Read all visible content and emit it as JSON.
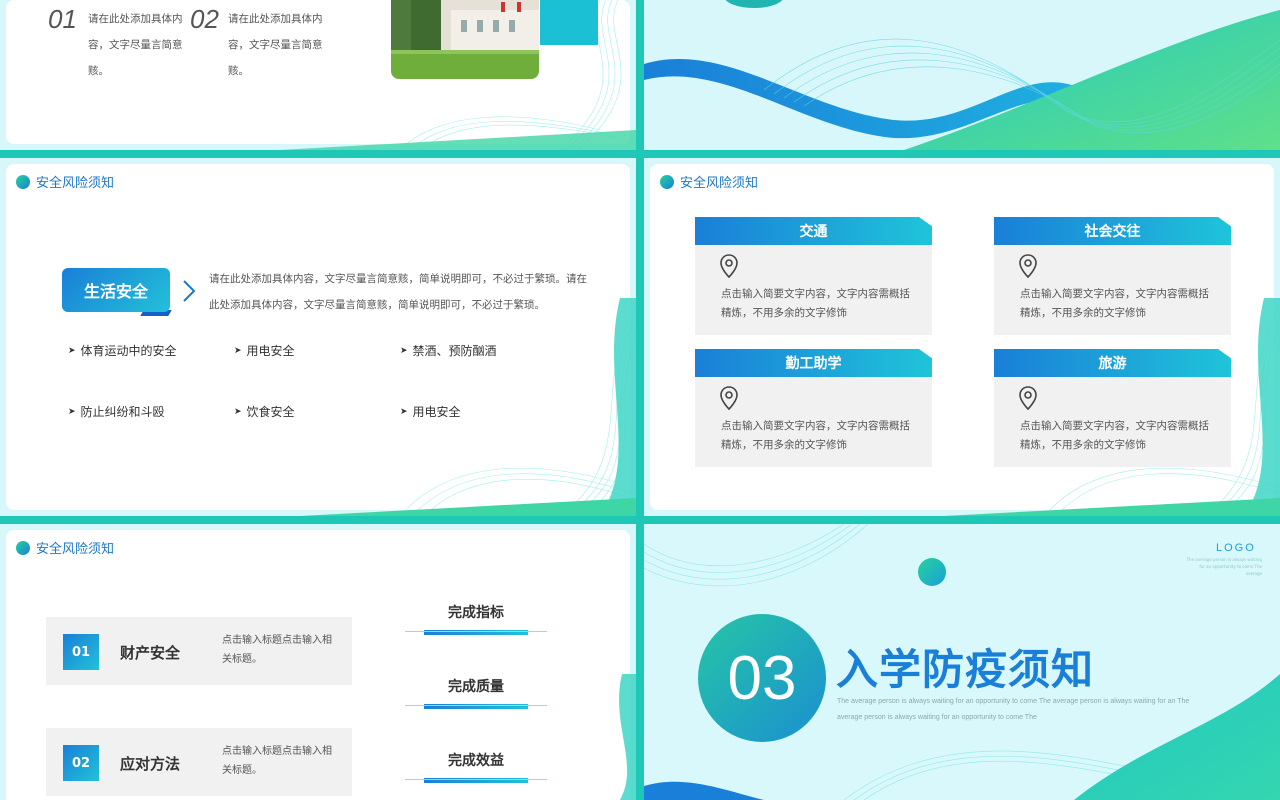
{
  "slide1": {
    "items": [
      {
        "num": "01",
        "text": "请在此处添加具体内容，文字尽量言简意赅。"
      },
      {
        "num": "02",
        "text": "请在此处添加具体内容，文字尽量言简意赅。"
      }
    ]
  },
  "slide3": {
    "section_title": "安全风险须知",
    "life_label": "生活安全",
    "description": "请在此处添加具体内容，文字尽量言简意赅，简单说明即可，不必过于繁琐。请在此处添加具体内容，文字尽量言简意赅，简单说明即可，不必过于繁琐。",
    "bullets": [
      "体育运动中的安全",
      "用电安全",
      "禁酒、预防酗酒",
      "防止纠纷和斗殴",
      "饮食安全",
      "用电安全"
    ]
  },
  "slide4": {
    "section_title": "安全风险须知",
    "cards": [
      {
        "title": "交通",
        "text": "点击输入简要文字内容，文字内容需概括精炼，不用多余的文字修饰"
      },
      {
        "title": "社会交往",
        "text": "点击输入简要文字内容，文字内容需概括精炼，不用多余的文字修饰"
      },
      {
        "title": "勤工助学",
        "text": "点击输入简要文字内容，文字内容需概括精炼，不用多余的文字修饰"
      },
      {
        "title": "旅游",
        "text": "点击输入简要文字内容，文字内容需概括精炼，不用多余的文字修饰"
      }
    ]
  },
  "slide5": {
    "section_title": "安全风险须知",
    "items": [
      {
        "num": "01",
        "title": "财产安全",
        "desc": "点击输入标题点击输入相关标题。"
      },
      {
        "num": "02",
        "title": "应对方法",
        "desc": "点击输入标题点击输入相关标题。"
      }
    ],
    "done": [
      "完成指标",
      "完成质量",
      "完成效益"
    ]
  },
  "slide6": {
    "logo": "LOGO",
    "logo_sub": "The average person is always waiting for an opportunity to come The average",
    "number": "03",
    "title": "入学防疫须知",
    "subtitle": "The average person is always waiting for an opportunity to come The average person is always waiting for an The average person is always waiting for an opportunity to come The"
  },
  "icons": {
    "section_dot": "gradient-dot-icon",
    "pin": "location-pin-icon",
    "arrow": "triangle-right-icon",
    "chevron": "chevron-right-icon"
  },
  "colors": {
    "accent_blue": "#1a7fd8",
    "accent_teal": "#1fc4d9",
    "accent_green": "#26d39c",
    "page_bg": "#1fc7b6"
  }
}
